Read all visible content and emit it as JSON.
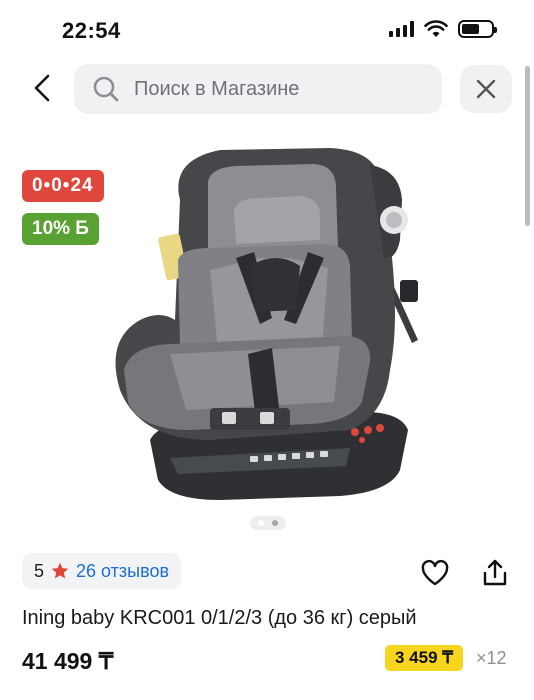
{
  "status_bar": {
    "time": "22:54",
    "icons": [
      "signal-icon",
      "wifi-icon",
      "battery-icon"
    ]
  },
  "nav": {
    "back_icon": "chevron-left-icon",
    "search_placeholder": "Поиск в Магазине",
    "search_icon": "search-icon",
    "close_icon": "close-icon"
  },
  "badges": {
    "installment": "0•0•24",
    "installment_color": "#e0473c",
    "bonus": "10% Б",
    "bonus_color": "#5aa133"
  },
  "gallery": {
    "image_alt": "car-seat-product-image",
    "dot_count": 2,
    "active_index": 0
  },
  "rating": {
    "value": "5",
    "star_icon": "star-icon",
    "star_color": "#e0473c",
    "reviews": "26 отзывов",
    "reviews_color": "#1b6fd6"
  },
  "actions": {
    "favorite_icon": "heart-icon",
    "share_icon": "share-icon"
  },
  "product": {
    "title": "Ining baby KRC001 0/1/2/3 (до 36 кг) серый",
    "price": "41 499 ₸",
    "monthly": "3 459 ₸",
    "monthly_color": "#f7d51e",
    "months": "×12"
  }
}
